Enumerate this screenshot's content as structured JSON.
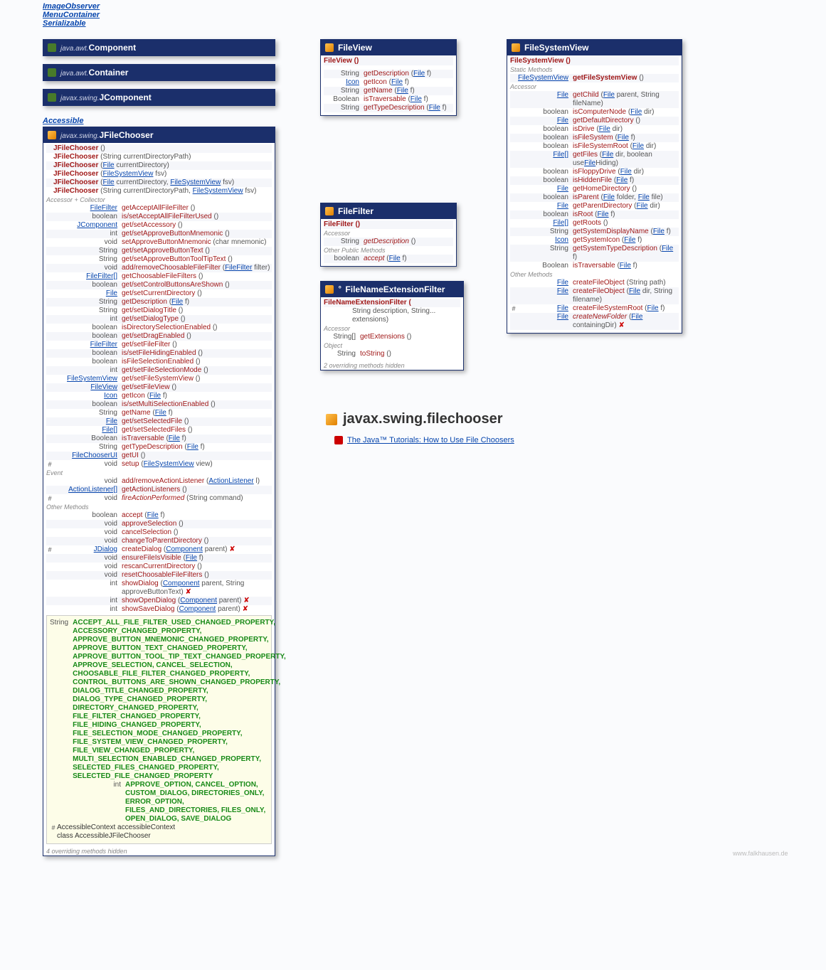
{
  "interfaces": [
    {
      "name": "ImageObserver"
    },
    {
      "name": "MenuContainer"
    },
    {
      "name": "Serializable"
    }
  ],
  "hierarchy": [
    {
      "pkg": "java.awt.",
      "cls": "Component"
    },
    {
      "pkg": "java.awt.",
      "cls": "Container"
    },
    {
      "pkg": "javax.swing.",
      "cls": "JComponent"
    }
  ],
  "accessible": "Accessible",
  "jfc": {
    "pkg": "javax.swing.",
    "title": "JFileChooser",
    "constructors": [
      {
        "sig": "()"
      },
      {
        "sig": "(String currentDirectoryPath)"
      },
      {
        "sig": "(File currentDirectory)",
        "links": [
          "File"
        ]
      },
      {
        "sig": "(FileSystemView fsv)",
        "links": [
          "FileSystemView"
        ]
      },
      {
        "sig": "(File currentDirectory, FileSystemView fsv)",
        "links": [
          "File",
          "FileSystemView"
        ]
      },
      {
        "sig": "(String currentDirectoryPath, FileSystemView fsv)",
        "links": [
          "FileSystemView"
        ]
      }
    ],
    "sections": [
      {
        "label": "Accessor + Collector",
        "rows": [
          {
            "ret": "FileFilter",
            "retLink": true,
            "name": "getAcceptAllFileFilter",
            "args": "()"
          },
          {
            "ret": "boolean",
            "name": "is/setAcceptAllFileFilterUsed",
            "args": "()"
          },
          {
            "ret": "JComponent",
            "retLink": true,
            "name": "get/setAccessory",
            "args": "()"
          },
          {
            "ret": "int",
            "name": "get/setApproveButtonMnemonic",
            "args": "()"
          },
          {
            "ret": "void",
            "name": "setApproveButtonMnemonic",
            "args": "(char mnemonic)"
          },
          {
            "ret": "String",
            "name": "get/setApproveButtonText",
            "args": "()"
          },
          {
            "ret": "String",
            "name": "get/setApproveButtonToolTipText",
            "args": "()"
          },
          {
            "ret": "void",
            "name": "add/removeChoosableFileFilter",
            "args": "(FileFilter filter)",
            "argLink": "FileFilter"
          },
          {
            "ret": "FileFilter[]",
            "retLink": true,
            "name": "getChoosableFileFilters",
            "args": "()"
          },
          {
            "ret": "boolean",
            "name": "get/setControlButtonsAreShown",
            "args": "()"
          },
          {
            "ret": "File",
            "retLink": true,
            "name": "get/setCurrentDirectory",
            "args": "()"
          },
          {
            "ret": "String",
            "name": "getDescription",
            "args": "(File f)",
            "argLink": "File"
          },
          {
            "ret": "String",
            "name": "get/setDialogTitle",
            "args": "()"
          },
          {
            "ret": "int",
            "name": "get/setDialogType",
            "args": "()"
          },
          {
            "ret": "boolean",
            "name": "isDirectorySelectionEnabled",
            "args": "()"
          },
          {
            "ret": "boolean",
            "name": "get/setDragEnabled",
            "args": "()"
          },
          {
            "ret": "FileFilter",
            "retLink": true,
            "name": "get/setFileFilter",
            "args": "()"
          },
          {
            "ret": "boolean",
            "name": "is/setFileHidingEnabled",
            "args": "()"
          },
          {
            "ret": "boolean",
            "name": "isFileSelectionEnabled",
            "args": "()"
          },
          {
            "ret": "int",
            "name": "get/setFileSelectionMode",
            "args": "()"
          },
          {
            "ret": "FileSystemView",
            "retLink": true,
            "name": "get/setFileSystemView",
            "args": "()"
          },
          {
            "ret": "FileView",
            "retLink": true,
            "name": "get/setFileView",
            "args": "()"
          },
          {
            "ret": "Icon",
            "retLink": true,
            "name": "getIcon",
            "args": "(File f)",
            "argLink": "File"
          },
          {
            "ret": "boolean",
            "name": "is/setMultiSelectionEnabled",
            "args": "()"
          },
          {
            "ret": "String",
            "name": "getName",
            "args": "(File f)",
            "argLink": "File"
          },
          {
            "ret": "File",
            "retLink": true,
            "name": "get/setSelectedFile",
            "args": "()"
          },
          {
            "ret": "File[]",
            "retLink": true,
            "name": "get/setSelectedFiles",
            "args": "()"
          },
          {
            "ret": "Boolean",
            "name": "isTraversable",
            "args": "(File f)",
            "argLink": "File"
          },
          {
            "ret": "String",
            "name": "getTypeDescription",
            "args": "(File f)",
            "argLink": "File"
          },
          {
            "ret": "FileChooserUI",
            "retLink": true,
            "name": "getUI",
            "args": "()"
          },
          {
            "pm": "#",
            "ret": "void",
            "name": "setup",
            "args": "(FileSystemView view)",
            "argLink": "FileSystemView"
          }
        ]
      },
      {
        "label": "Event",
        "rows": [
          {
            "ret": "void",
            "name": "add/removeActionListener",
            "args": "(ActionListener l)",
            "argLink": "ActionListener"
          },
          {
            "ret": "ActionListener[]",
            "retLink": true,
            "name": "getActionListeners",
            "args": "()"
          },
          {
            "pm": "#",
            "ret": "void",
            "name": "fireActionPerformed",
            "args": "(String command)",
            "italic": true
          }
        ]
      },
      {
        "label": "Other Methods",
        "rows": [
          {
            "ret": "boolean",
            "name": "accept",
            "args": "(File f)",
            "argLink": "File"
          },
          {
            "ret": "void",
            "name": "approveSelection",
            "args": "()"
          },
          {
            "ret": "void",
            "name": "cancelSelection",
            "args": "()"
          },
          {
            "ret": "void",
            "name": "changeToParentDirectory",
            "args": "()"
          },
          {
            "pm": "#",
            "ret": "JDialog",
            "retLink": true,
            "name": "createDialog",
            "args": "(Component parent)",
            "argLink": "Component",
            "throws": true
          },
          {
            "ret": "void",
            "name": "ensureFileIsVisible",
            "args": "(File f)",
            "argLink": "File"
          },
          {
            "ret": "void",
            "name": "rescanCurrentDirectory",
            "args": "()"
          },
          {
            "ret": "void",
            "name": "resetChoosableFileFilters",
            "args": "()"
          },
          {
            "ret": "int",
            "name": "showDialog",
            "args": "(Component parent, String approveButtonText)",
            "argLink": "Component",
            "throws": true
          },
          {
            "ret": "int",
            "name": "showOpenDialog",
            "args": "(Component parent)",
            "argLink": "Component",
            "throws": true
          },
          {
            "ret": "int",
            "name": "showSaveDialog",
            "args": "(Component parent)",
            "argLink": "Component",
            "throws": true
          }
        ]
      }
    ],
    "constants": {
      "strings": [
        "ACCEPT_ALL_FILE_FILTER_USED_CHANGED_PROPERTY,",
        "ACCESSORY_CHANGED_PROPERTY,",
        "APPROVE_BUTTON_MNEMONIC_CHANGED_PROPERTY,",
        "APPROVE_BUTTON_TEXT_CHANGED_PROPERTY,",
        "APPROVE_BUTTON_TOOL_TIP_TEXT_CHANGED_PROPERTY,",
        "APPROVE_SELECTION, CANCEL_SELECTION,",
        "CHOOSABLE_FILE_FILTER_CHANGED_PROPERTY,",
        "CONTROL_BUTTONS_ARE_SHOWN_CHANGED_PROPERTY,",
        "DIALOG_TITLE_CHANGED_PROPERTY,",
        "DIALOG_TYPE_CHANGED_PROPERTY,",
        "DIRECTORY_CHANGED_PROPERTY,",
        "FILE_FILTER_CHANGED_PROPERTY,",
        "FILE_HIDING_CHANGED_PROPERTY,",
        "FILE_SELECTION_MODE_CHANGED_PROPERTY,",
        "FILE_SYSTEM_VIEW_CHANGED_PROPERTY,",
        "FILE_VIEW_CHANGED_PROPERTY,",
        "MULTI_SELECTION_ENABLED_CHANGED_PROPERTY,",
        "SELECTED_FILES_CHANGED_PROPERTY,",
        "SELECTED_FILE_CHANGED_PROPERTY"
      ],
      "ints": "APPROVE_OPTION, CANCEL_OPTION, CUSTOM_DIALOG, DIRECTORIES_ONLY, ERROR_OPTION, FILES_AND_DIRECTORIES, FILES_ONLY, OPEN_DIALOG, SAVE_DIALOG",
      "ctx": "AccessibleContext accessibleContext",
      "inner": "class AccessibleJFileChooser"
    },
    "hidden": "4 overriding methods hidden"
  },
  "fileview": {
    "title": "FileView",
    "ctor": "FileView ()",
    "rows": [
      {
        "ret": "String",
        "name": "getDescription",
        "args": "(File f)",
        "argLink": "File"
      },
      {
        "ret": "Icon",
        "retLink": true,
        "name": "getIcon",
        "args": "(File f)",
        "argLink": "File"
      },
      {
        "ret": "String",
        "name": "getName",
        "args": "(File f)",
        "argLink": "File"
      },
      {
        "ret": "Boolean",
        "name": "isTraversable",
        "args": "(File f)",
        "argLink": "File"
      },
      {
        "ret": "String",
        "name": "getTypeDescription",
        "args": "(File f)",
        "argLink": "File"
      }
    ]
  },
  "filefilter": {
    "title": "FileFilter",
    "ctor": "FileFilter ()",
    "sections": [
      {
        "label": "Accessor",
        "rows": [
          {
            "ret": "String",
            "name": "getDescription",
            "args": "()",
            "italic": true
          }
        ]
      },
      {
        "label": "Other Public Methods",
        "rows": [
          {
            "ret": "boolean",
            "name": "accept",
            "args": "(File f)",
            "argLink": "File",
            "italic": true
          }
        ]
      }
    ]
  },
  "fnef": {
    "title": "FileNameExtensionFilter",
    "ctor": "FileNameExtensionFilter (",
    "ctor2": "String description, String... extensions)",
    "sections": [
      {
        "label": "Accessor",
        "rows": [
          {
            "ret": "String[]",
            "name": "getExtensions",
            "args": "()"
          }
        ]
      },
      {
        "label": "Object",
        "rows": [
          {
            "ret": "String",
            "name": "toString",
            "args": "()"
          }
        ]
      }
    ],
    "hidden": "2 overriding methods hidden"
  },
  "fsv": {
    "title": "FileSystemView",
    "ctor": "FileSystemView ()",
    "sections": [
      {
        "label": "Static Methods",
        "rows": [
          {
            "ret": "FileSystemView",
            "retLink": true,
            "name": "getFileSystemView",
            "args": "()",
            "bold": true
          }
        ]
      },
      {
        "label": "Accessor",
        "rows": [
          {
            "ret": "File",
            "retLink": true,
            "name": "getChild",
            "args": "(File parent, String fileName)",
            "argLink": "File"
          },
          {
            "ret": "boolean",
            "name": "isComputerNode",
            "args": "(File dir)",
            "argLink": "File"
          },
          {
            "ret": "File",
            "retLink": true,
            "name": "getDefaultDirectory",
            "args": "()"
          },
          {
            "ret": "boolean",
            "name": "isDrive",
            "args": "(File dir)",
            "argLink": "File"
          },
          {
            "ret": "boolean",
            "name": "isFileSystem",
            "args": "(File f)",
            "argLink": "File"
          },
          {
            "ret": "boolean",
            "name": "isFileSystemRoot",
            "args": "(File dir)",
            "argLink": "File"
          },
          {
            "ret": "File[]",
            "retLink": true,
            "name": "getFiles",
            "args": "(File dir, boolean useFileHiding)",
            "argLink": "File"
          },
          {
            "ret": "boolean",
            "name": "isFloppyDrive",
            "args": "(File dir)",
            "argLink": "File"
          },
          {
            "ret": "boolean",
            "name": "isHiddenFile",
            "args": "(File f)",
            "argLink": "File"
          },
          {
            "ret": "File",
            "retLink": true,
            "name": "getHomeDirectory",
            "args": "()"
          },
          {
            "ret": "boolean",
            "name": "isParent",
            "args": "(File folder, File file)",
            "argLink": "File"
          },
          {
            "ret": "File",
            "retLink": true,
            "name": "getParentDirectory",
            "args": "(File dir)",
            "argLink": "File"
          },
          {
            "ret": "boolean",
            "name": "isRoot",
            "args": "(File f)",
            "argLink": "File"
          },
          {
            "ret": "File[]",
            "retLink": true,
            "name": "getRoots",
            "args": "()"
          },
          {
            "ret": "String",
            "name": "getSystemDisplayName",
            "args": "(File f)",
            "argLink": "File"
          },
          {
            "ret": "Icon",
            "retLink": true,
            "name": "getSystemIcon",
            "args": "(File f)",
            "argLink": "File"
          },
          {
            "ret": "String",
            "name": "getSystemTypeDescription",
            "args": "(File f)",
            "argLink": "File"
          },
          {
            "ret": "Boolean",
            "name": "isTraversable",
            "args": "(File f)",
            "argLink": "File"
          }
        ]
      },
      {
        "label": "Other Methods",
        "rows": [
          {
            "ret": "File",
            "retLink": true,
            "name": "createFileObject",
            "args": "(String path)"
          },
          {
            "ret": "File",
            "retLink": true,
            "name": "createFileObject",
            "args": "(File dir, String filename)",
            "argLink": "File"
          },
          {
            "pm": "#",
            "ret": "File",
            "retLink": true,
            "name": "createFileSystemRoot",
            "args": "(File f)",
            "argLink": "File"
          },
          {
            "ret": "File",
            "retLink": true,
            "name": "createNewFolder",
            "args": "(File containingDir)",
            "argLink": "File",
            "italic": true,
            "throws": true
          }
        ]
      }
    ]
  },
  "pkgTitle": "javax.swing.filechooser",
  "tutorialLabel": "The Java™ Tutorials: How to Use File Choosers",
  "footer": "www.falkhausen.de"
}
